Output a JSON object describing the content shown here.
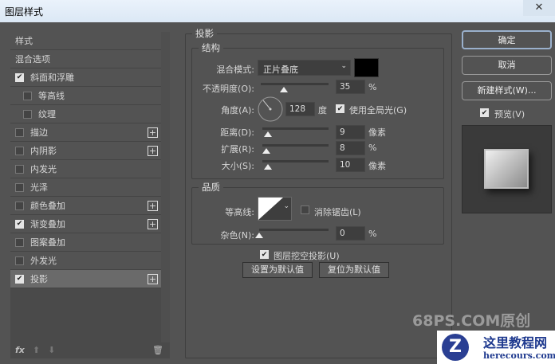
{
  "title": "图层样式",
  "close": "✕",
  "sidebar": {
    "items": [
      {
        "label": "样式",
        "checkbox": null,
        "plus": false
      },
      {
        "label": "混合选项",
        "checkbox": null,
        "plus": false
      },
      {
        "label": "斜面和浮雕",
        "checkbox": true,
        "plus": false
      },
      {
        "label": "等高线",
        "checkbox": false,
        "plus": false,
        "sub": true
      },
      {
        "label": "纹理",
        "checkbox": false,
        "plus": false,
        "sub": true
      },
      {
        "label": "描边",
        "checkbox": false,
        "plus": true
      },
      {
        "label": "内阴影",
        "checkbox": false,
        "plus": true
      },
      {
        "label": "内发光",
        "checkbox": false,
        "plus": false
      },
      {
        "label": "光泽",
        "checkbox": false,
        "plus": false
      },
      {
        "label": "颜色叠加",
        "checkbox": false,
        "plus": true
      },
      {
        "label": "渐变叠加",
        "checkbox": true,
        "plus": true
      },
      {
        "label": "图案叠加",
        "checkbox": false,
        "plus": false
      },
      {
        "label": "外发光",
        "checkbox": false,
        "plus": false
      },
      {
        "label": "投影",
        "checkbox": true,
        "plus": true,
        "selected": true
      }
    ],
    "fx": "fx",
    "up": "⬆",
    "down": "⬇",
    "trash": "🗑"
  },
  "main": {
    "group": "投影",
    "structure": {
      "title": "结构",
      "blend_label": "混合模式:",
      "blend_value": "正片叠底",
      "color": "#000000",
      "opacity_label": "不透明度(O):",
      "opacity": "35",
      "opacity_unit": "%",
      "angle_label": "角度(A):",
      "angle": "128",
      "angle_unit": "度",
      "global_light": "使用全局光(G)",
      "distance_label": "距离(D):",
      "distance": "9",
      "distance_unit": "像素",
      "spread_label": "扩展(R):",
      "spread": "8",
      "spread_unit": "%",
      "size_label": "大小(S):",
      "size": "10",
      "size_unit": "像素"
    },
    "quality": {
      "title": "品质",
      "contour_label": "等高线:",
      "antialias": "消除锯齿(L)",
      "noise_label": "杂色(N):",
      "noise": "0",
      "noise_unit": "%"
    },
    "knockout": "图层挖空投影(U)",
    "set_default": "设置为默认值",
    "reset_default": "复位为默认值"
  },
  "right": {
    "ok": "确定",
    "cancel": "取消",
    "new_style": "新建样式(W)...",
    "preview": "预览(V)"
  },
  "watermark": "68PS.COM原创",
  "logo": {
    "title": "这里教程网",
    "url": "herecours.com"
  }
}
